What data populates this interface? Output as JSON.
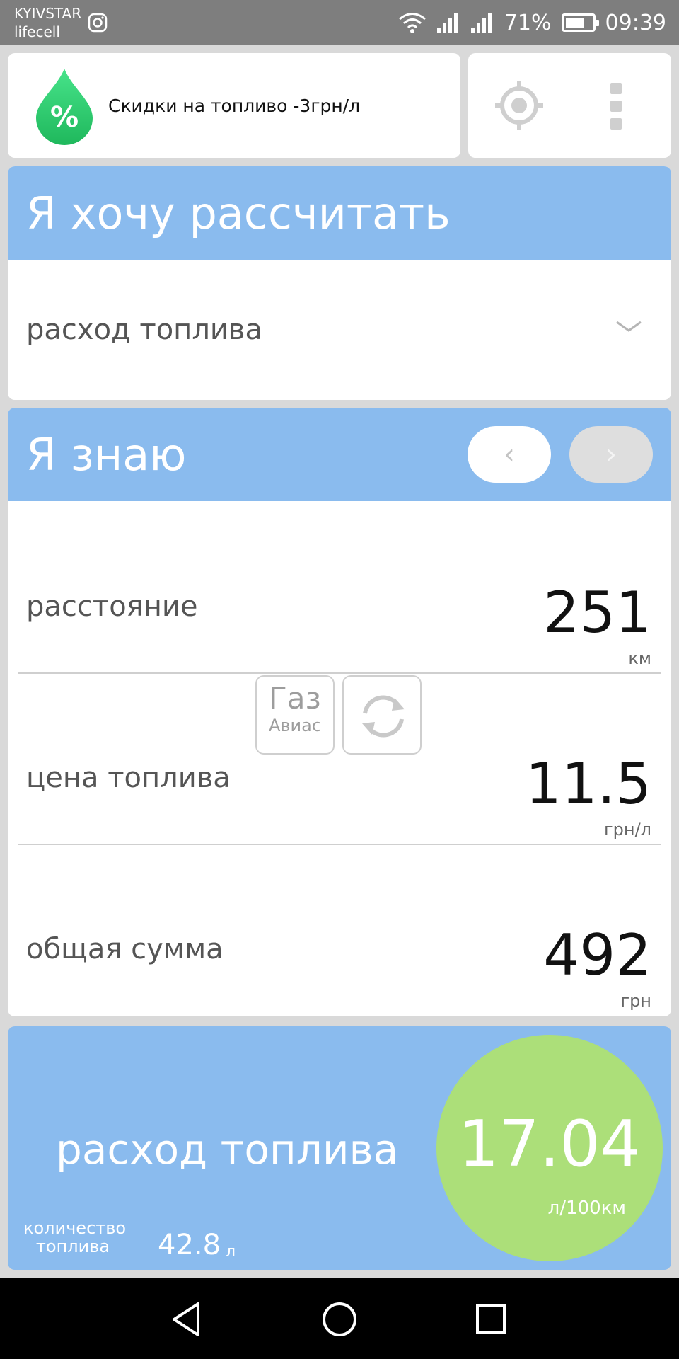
{
  "status_bar": {
    "carrier_1": "KYIVSTAR",
    "carrier_2": "lifecell",
    "battery_percent": "71%",
    "battery_level": 0.71,
    "time": "09:39"
  },
  "promo": {
    "icon": "percent-drop-icon",
    "text": "Скидки на топливо -3грн/л"
  },
  "calculate": {
    "title": "Я хочу рассчитать",
    "selected": "расход топлива"
  },
  "known": {
    "title": "Я знаю",
    "prev_glyph": "‹",
    "next_glyph": "›",
    "fields": [
      {
        "label": "расстояние",
        "value": "251",
        "unit": "км"
      },
      {
        "label": "цена топлива",
        "value": "11.5",
        "unit": "грн/л"
      },
      {
        "label": "общая сумма",
        "value": "492",
        "unit": "грн"
      }
    ],
    "fuel_type": {
      "main": "Газ",
      "sub": "Авиас"
    }
  },
  "result": {
    "label": "расход топлива",
    "value": "17.04",
    "unit": "л/100км",
    "quantity_label": "количество топлива",
    "quantity_value": "42.8",
    "quantity_unit": "л"
  },
  "colors": {
    "header_blue": "#8abbee",
    "result_green": "#acdf79",
    "promo_green": "#2fcc6f"
  }
}
